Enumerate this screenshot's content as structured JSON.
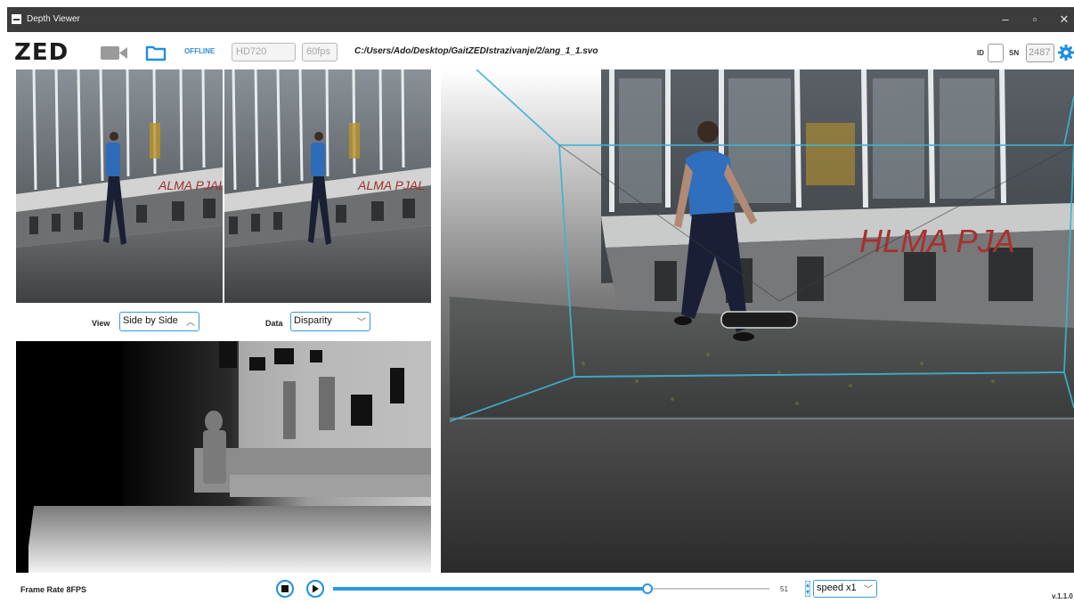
{
  "window": {
    "title": "Depth Viewer"
  },
  "toolbar": {
    "logo": "ZED",
    "status": "OFFLINE",
    "resolution": "HD720",
    "fps": "60fps",
    "file_path": "C:/Users/Ado/Desktop/GaitZEDIstrazivanje/2/ang_1_1.svo",
    "id_label": "ID",
    "id_value": "",
    "sn_label": "SN",
    "sn_value": "2487"
  },
  "controls": {
    "view_label": "View",
    "view_value": "Side by Side",
    "data_label": "Data",
    "data_value": "Disparity"
  },
  "bottom": {
    "frame_rate": "Frame Rate 8FPS",
    "frame_number": "51",
    "speed": "speed x1",
    "version": "v.1.1.0",
    "progress": 0.72
  },
  "colors": {
    "accent": "#1f8ee0",
    "titlebar": "#3c3c3c"
  },
  "icons": {
    "camera": "video-camera-icon",
    "folder": "folder-icon",
    "settings": "gear-icon",
    "stop": "stop-icon",
    "play": "play-icon"
  }
}
